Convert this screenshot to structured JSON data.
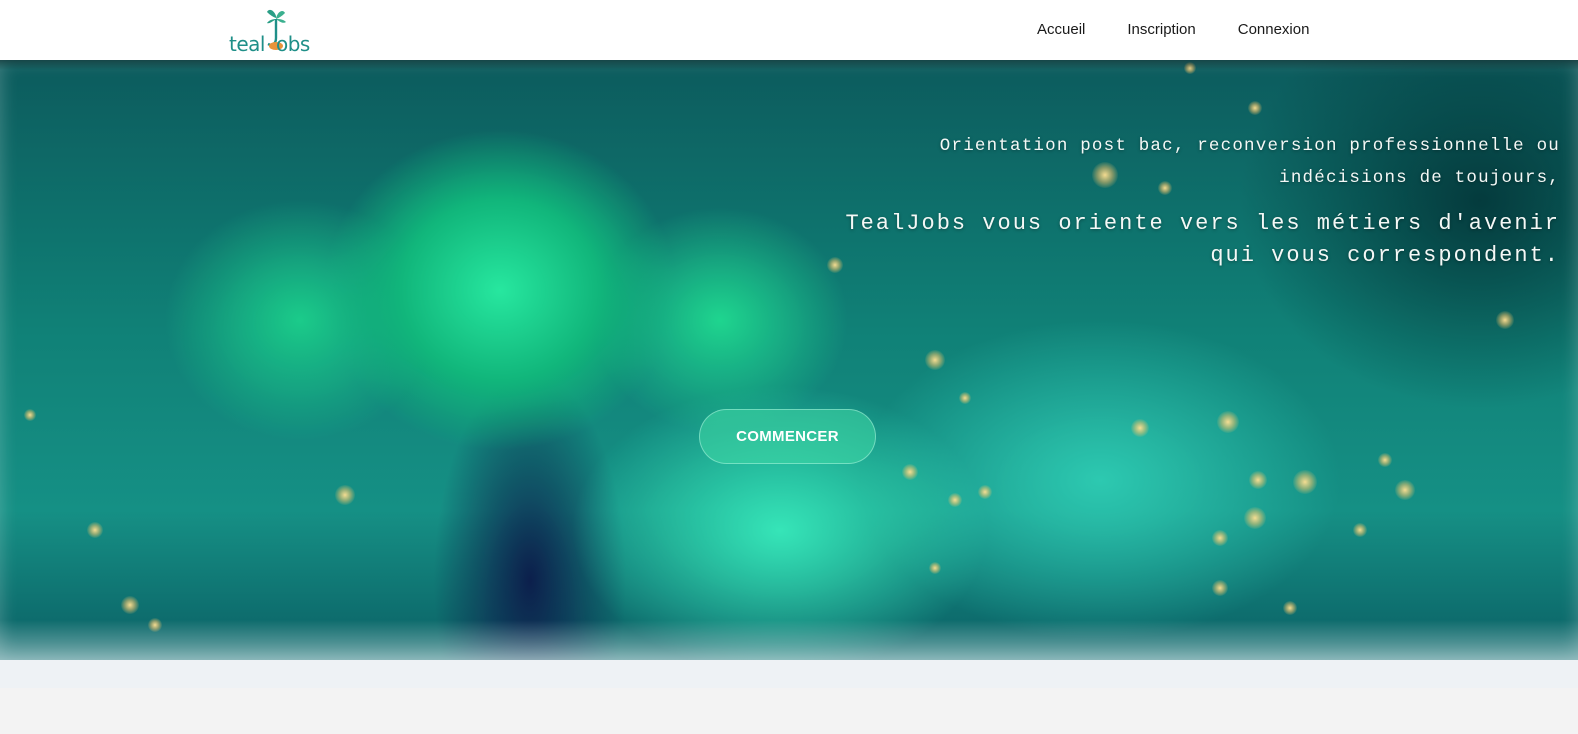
{
  "header": {
    "logo": {
      "text_pre": "teal",
      "text_post": "obs",
      "icon": "sprout-j-icon"
    },
    "nav": [
      {
        "label": "Accueil"
      },
      {
        "label": "Inscription"
      },
      {
        "label": "Connexion"
      }
    ]
  },
  "hero": {
    "intro": "Orientation post bac, reconversion professionnelle ou indécisions de toujours,",
    "tagline": "TealJobs vous oriente vers les métiers d'avenir qui vous correspondent.",
    "cta_label": "COMMENCER"
  },
  "colors": {
    "brand_teal": "#1f8f88",
    "leaf_orange": "#e8943a",
    "hero_green": "#2ee5a0"
  }
}
